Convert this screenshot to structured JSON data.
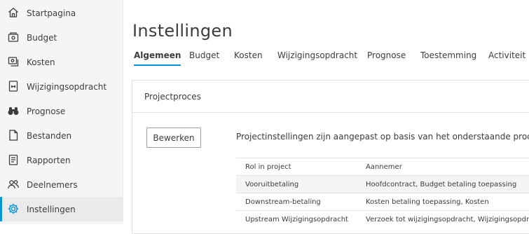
{
  "sidebar": {
    "items": [
      {
        "label": "Startpagina",
        "icon": "home-icon"
      },
      {
        "label": "Budget",
        "icon": "budget-icon"
      },
      {
        "label": "Kosten",
        "icon": "cost-icon"
      },
      {
        "label": "Wijzigingsopdracht",
        "icon": "change-order-icon"
      },
      {
        "label": "Prognose",
        "icon": "binoculars-icon"
      },
      {
        "label": "Bestanden",
        "icon": "file-icon"
      },
      {
        "label": "Rapporten",
        "icon": "report-icon"
      },
      {
        "label": "Deelnemers",
        "icon": "people-icon"
      },
      {
        "label": "Instellingen",
        "icon": "gear-icon",
        "active": true
      }
    ]
  },
  "page": {
    "title": "Instellingen"
  },
  "tabs": [
    {
      "label": "Algemeen",
      "active": true
    },
    {
      "label": "Budget"
    },
    {
      "label": "Kosten"
    },
    {
      "label": "Wijzigingsopdracht"
    },
    {
      "label": "Prognose"
    },
    {
      "label": "Toestemming"
    },
    {
      "label": "Activiteit"
    }
  ],
  "panel": {
    "title": "Projectproces",
    "edit_label": "Bewerken",
    "description": "Projectinstellingen zijn aangepast op basis van het onderstaande proces.",
    "table": {
      "headers": [
        "Rol in project",
        "Aannemer"
      ],
      "rows": [
        [
          "Vooruitbetaling",
          "Hoofdcontract, Budget betaling toepassing"
        ],
        [
          "Downstream-betaling",
          "Kosten betaling toepassing, Kosten"
        ],
        [
          "Upstream Wijzigingsopdracht",
          "Verzoek tot wijzigingsopdracht, Wijzigingsopdracht"
        ]
      ]
    }
  },
  "colors": {
    "accent": "#0696d7",
    "sidebar_bg": "#f5f5f5",
    "text": "#3c3c3c"
  }
}
